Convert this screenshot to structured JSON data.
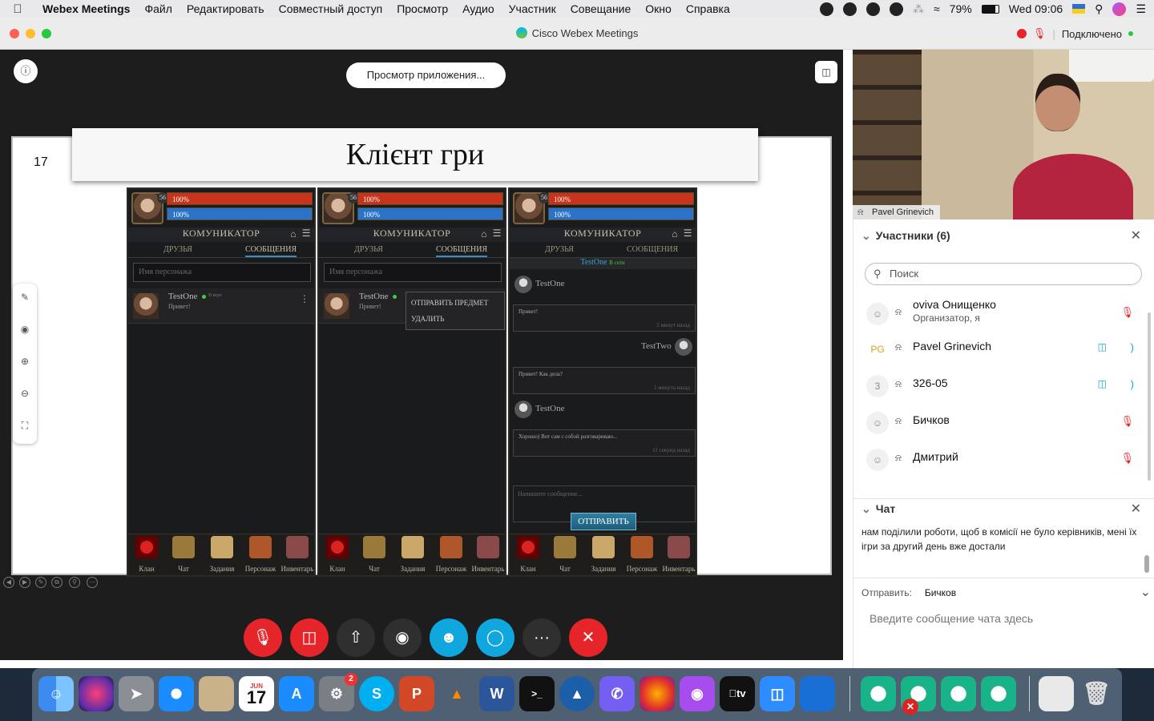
{
  "menubar": {
    "app": "Webex Meetings",
    "items": [
      "Файл",
      "Редактировать",
      "Совместный доступ",
      "Просмотр",
      "Аудио",
      "Участник",
      "Совещание",
      "Окно",
      "Справка"
    ],
    "battery": "79%",
    "clock": "Wed 09:06"
  },
  "window": {
    "title": "Cisco Webex Meetings",
    "status": "Подключено"
  },
  "share": {
    "app_view_button": "Просмотр приложения...",
    "slide": {
      "number": "17",
      "title": "Клієнт гри"
    },
    "game": {
      "hp": "100%",
      "mp": "100%",
      "level": "56",
      "header": "КОМУНИКАТОР",
      "tab_friends": "ДРУЗЬЯ",
      "tab_messages": "СООБЩЕНИЯ",
      "search_placeholder": "Имя персонажа",
      "contact_name": "TestOne",
      "contact_status": "В игре",
      "contact_preview": "Привет!",
      "menu_send_item": "ОТПРАВИТЬ ПРЕДМЕТ",
      "menu_delete": "УДАЛИТЬ",
      "chat_header_name": "TestOne",
      "chat_header_status": "В сети",
      "messages": [
        {
          "author": "TestOne",
          "text": "Привет!",
          "time": "5 минут назад"
        },
        {
          "author": "TestTwo",
          "text": "Привет! Как дела?",
          "time": "1 минута назад"
        },
        {
          "author": "TestOne",
          "text": "Хорошо) Вот сам с собой разговариваю...",
          "time": "11 секунд назад"
        }
      ],
      "message_placeholder": "Напишите сообщение...",
      "send_button": "ОТПРАВИТЬ",
      "nav": [
        "Клан",
        "Чат",
        "Задания",
        "Персонаж",
        "Инвентарь"
      ]
    }
  },
  "controls": {
    "mute": "mic-muted-icon",
    "video": "video-off-icon",
    "share": "share-icon",
    "record": "record-icon",
    "participants": "participants-icon",
    "chat": "chat-icon",
    "more": "···",
    "leave": "✕"
  },
  "video": {
    "name": "Pavel Grinevich"
  },
  "participants": {
    "title": "Участники (6)",
    "search_placeholder": "Поиск",
    "list": [
      {
        "name": "oviva Онищенко",
        "role": "Организатор, я",
        "avatar": "",
        "mic": "muted"
      },
      {
        "name": "Pavel Grinevich",
        "role": "",
        "avatar": "PG",
        "mic": "active"
      },
      {
        "name": "326-05",
        "role": "",
        "avatar": "3",
        "mic": "active"
      },
      {
        "name": "Бичков",
        "role": "",
        "avatar": "",
        "mic": "muted"
      },
      {
        "name": "Дмитрий",
        "role": "",
        "avatar": "",
        "mic": "muted"
      }
    ]
  },
  "chat": {
    "title": "Чат",
    "message": "нам поділили роботи, щоб в комісії не було керівників, мені їх ігри за другий день вже достали",
    "send_to_label": "Отправить:",
    "send_to_value": "Бичков",
    "input_placeholder": "Введите сообщение чата здесь"
  },
  "colors": {
    "accent_blue": "#0fa7dd",
    "danger_red": "#e5252a",
    "hp_red": "#c9331c",
    "mp_blue": "#2b73c8"
  },
  "dock": {
    "calendar_day": "17",
    "calendar_month": "JUN",
    "prefs_badge": "2"
  }
}
